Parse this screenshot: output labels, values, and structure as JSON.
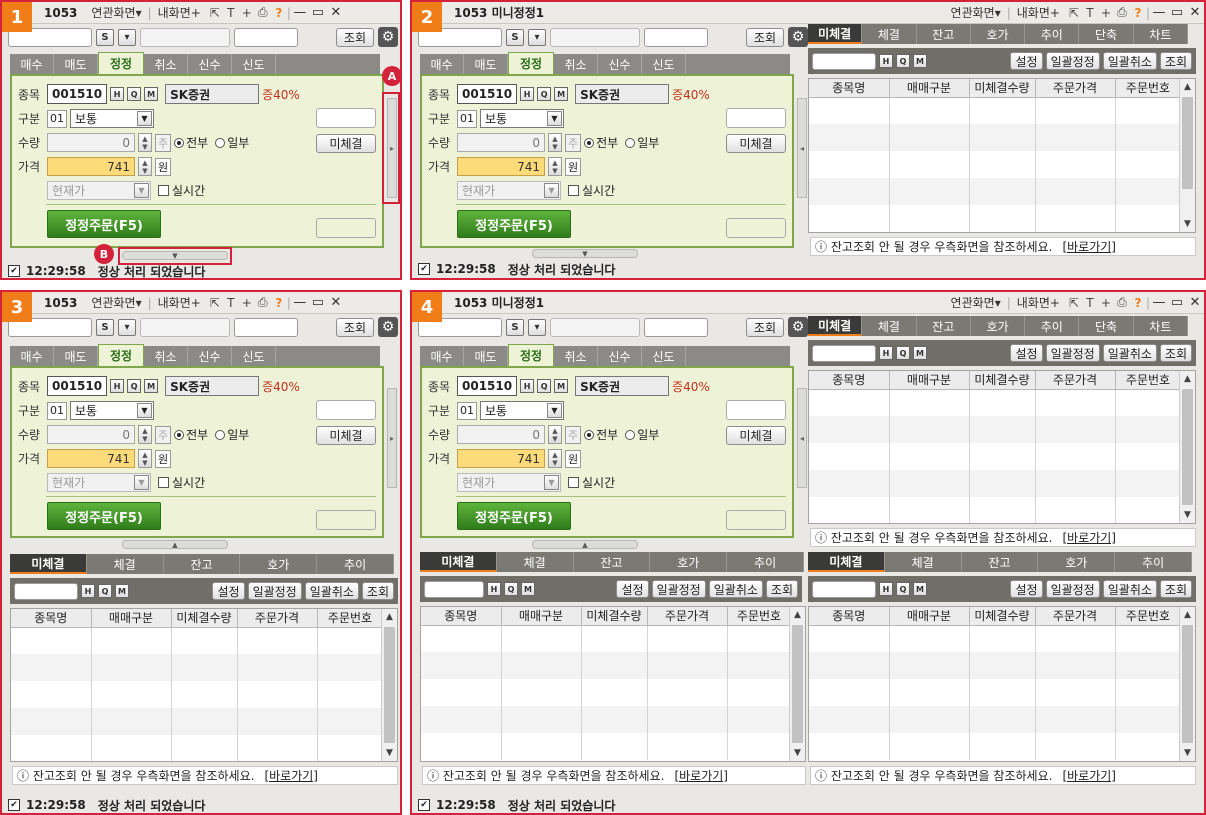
{
  "panels": [
    {
      "badge": "1",
      "title": "1053",
      "menu": [
        "연관화면▾",
        "내화면+"
      ]
    },
    {
      "badge": "2",
      "title": "1053 미니정정1",
      "menu": [
        "연관화면▾",
        "내화면+"
      ]
    },
    {
      "badge": "3",
      "title": "1053",
      "menu": [
        "연관화면▾",
        "내화면+"
      ]
    },
    {
      "badge": "4",
      "title": "1053 미니정정1",
      "menu": [
        "연관화면▾",
        "내화면+"
      ]
    }
  ],
  "toolbar": {
    "s_label": "S",
    "dropdown": "▾",
    "query_button": "조회",
    "gear": "⚙"
  },
  "order_tabs": [
    "매수",
    "매도",
    "정정",
    "취소",
    "신수",
    "신도"
  ],
  "order": {
    "stock_label": "종목",
    "stock_code": "001510",
    "hqm": [
      "H",
      "Q",
      "M"
    ],
    "stock_name": "SK증권",
    "margin": "증40%",
    "type_label": "구분",
    "type_code": "01",
    "type_value": "보통",
    "qty_label": "수량",
    "qty_value": "0",
    "qty_unit": "주",
    "radio_all": "전부",
    "radio_part": "일부",
    "unfilled_button": "미체결",
    "price_label": "가격",
    "price_value": "741",
    "price_unit": "원",
    "current_price": "현재가",
    "realtime": "실시간",
    "order_button": "정정주문(F5)"
  },
  "markers": {
    "a": "A",
    "b": "B"
  },
  "status": {
    "check": "✔",
    "time": "12:29:58",
    "message": "정상 처리 되었습니다"
  },
  "conclusion_tabs": [
    "미체결",
    "체결",
    "잔고",
    "호가",
    "추이"
  ],
  "conclusion_tabs_wide": [
    "미체결",
    "체결",
    "잔고",
    "호가",
    "추이",
    "단축",
    "차트"
  ],
  "conclusion_tools": [
    "설정",
    "일괄정정",
    "일괄취소",
    "조회"
  ],
  "grid_headers": [
    "종목명",
    "매매구분",
    "미체결수량",
    "주문가격",
    "주문번호"
  ],
  "note": {
    "text": "ⓘ 잔고조회 안 될 경우 우측화면을 참조하세요.",
    "link": "[바로가기]"
  },
  "colors": {
    "accent": "#f07d18",
    "annotation": "#d4223a",
    "order_green": "#2f7d1b"
  }
}
